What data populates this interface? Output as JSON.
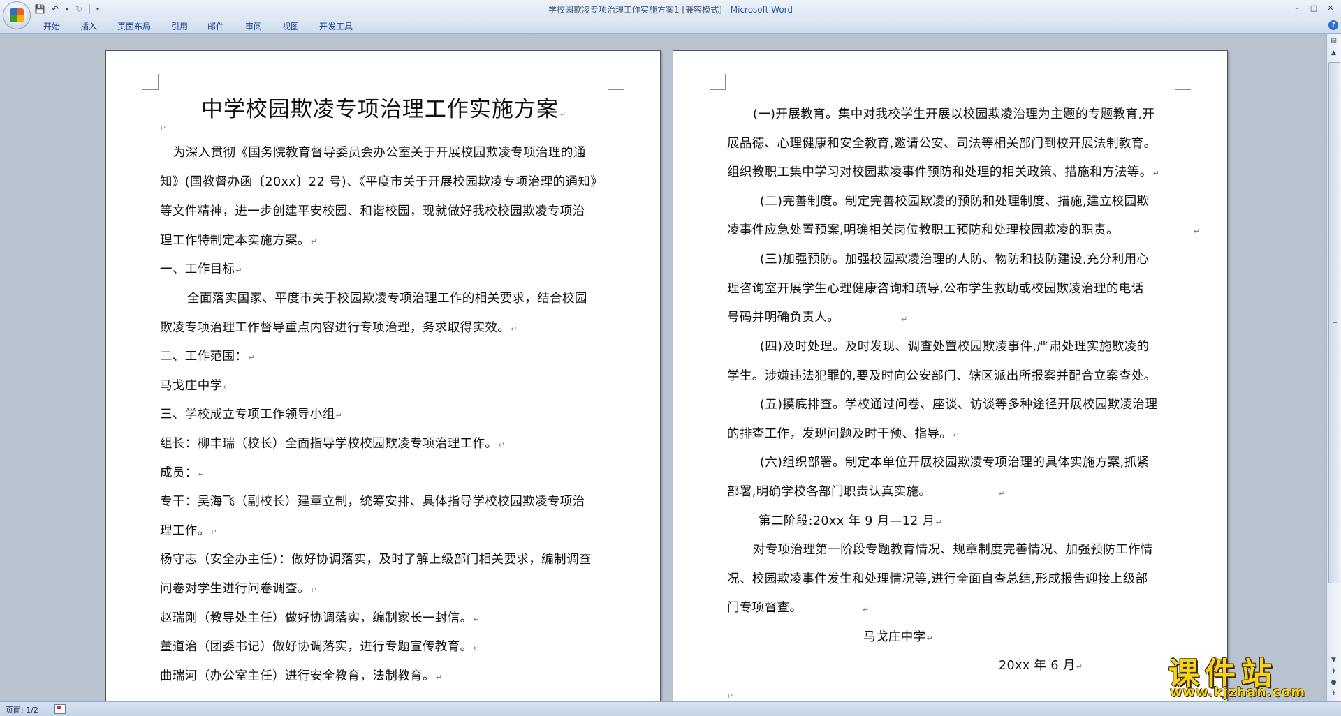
{
  "window": {
    "title": "学校园欺凌专项治理工作实施方案1 [兼容模式] - ",
    "app_name": "Microsoft Word",
    "controls": [
      "–",
      "□",
      "✕"
    ]
  },
  "ribbon": {
    "tabs": [
      "开始",
      "插入",
      "页面布局",
      "引用",
      "邮件",
      "审阅",
      "视图",
      "开发工具"
    ],
    "help": "?"
  },
  "document": {
    "title": "中学校园欺凌专项治理工作实施方案",
    "left_page_lines": [
      "为深入贯彻《国务院教育督导委员会办公室关于开展校园欺凌专项治理的通",
      "知》(国教督办函〔20xx〕22 号)、《平度市关于开展校园欺凌专项治理的通知》",
      "等文件精神，进一步创建平安校园、和谐校园，现就做好我校校园欺凌专项治",
      "理工作特制定本实施方案。",
      "一、工作目标",
      "全面落实国家、平度市关于校园欺凌专项治理工作的相关要求，结合校园",
      "欺凌专项治理工作督导重点内容进行专项治理，务求取得实效。",
      "二、工作范围：",
      "马戈庄中学",
      "三、学校成立专项工作领导小组",
      "组长：柳丰瑞（校长）全面指导学校校园欺凌专项治理工作。",
      "成员：",
      "专干：吴海飞（副校长）建章立制，统筹安排、具体指导学校校园欺凌专项治",
      "理工作。",
      "杨守志（安全办主任）：做好协调落实，及时了解上级部门相关要求，编制调查",
      "问卷对学生进行问卷调查。",
      "赵瑞刚（教导处主任）做好协调落实，编制家长一封信。",
      "董道治（团委书记）做好协调落实，进行专题宣传教育。",
      "曲瑞河（办公室主任）进行安全教育，法制教育。"
    ],
    "right_page_lines": [
      "(一)开展教育。集中对我校学生开展以校园欺凌治理为主题的专题教育,开",
      "展品德、心理健康和安全教育,邀请公安、司法等相关部门到校开展法制教育。",
      "组织教职工集中学习对校园欺凌事件预防和处理的相关政策、措施和方法等。",
      "(二)完善制度。制定完善校园欺凌的预防和处理制度、措施,建立校园欺",
      "凌事件应急处置预案,明确相关岗位教职工预防和处理校园欺凌的职责。",
      "(三)加强预防。加强校园欺凌治理的人防、物防和技防建设,充分利用心",
      "理咨询室开展学生心理健康咨询和疏导,公布学生救助或校园欺凌治理的电话",
      "号码并明确负责人。",
      "(四)及时处理。及时发现、调查处置校园欺凌事件,严肃处理实施欺凌的",
      "学生。涉嫌违法犯罪的,要及时向公安部门、辖区派出所报案并配合立案查处。",
      "(五)摸底排查。学校通过问卷、座谈、访谈等多种途径开展校园欺凌治理",
      "的排查工作，发现问题及时干预、指导。",
      "(六)组织部署。制定本单位开展校园欺凌专项治理的具体实施方案,抓紧",
      "部署,明确学校各部门职责认真实施。",
      "第二阶段:20xx 年 9 月—12 月",
      "对专项治理第一阶段专题教育情况、规章制度完善情况、加强预防工作情",
      "况、校园欺凌事件发生和处理情况等,进行全面自查总结,形成报告迎接上级部",
      "门专项督查。",
      "马戈庄中学",
      "20xx 年 6 月"
    ]
  },
  "statusbar": {
    "page_info": "页面: 1/2"
  },
  "watermark": {
    "name": "课件站",
    "url": "www.kjzhan.com"
  }
}
